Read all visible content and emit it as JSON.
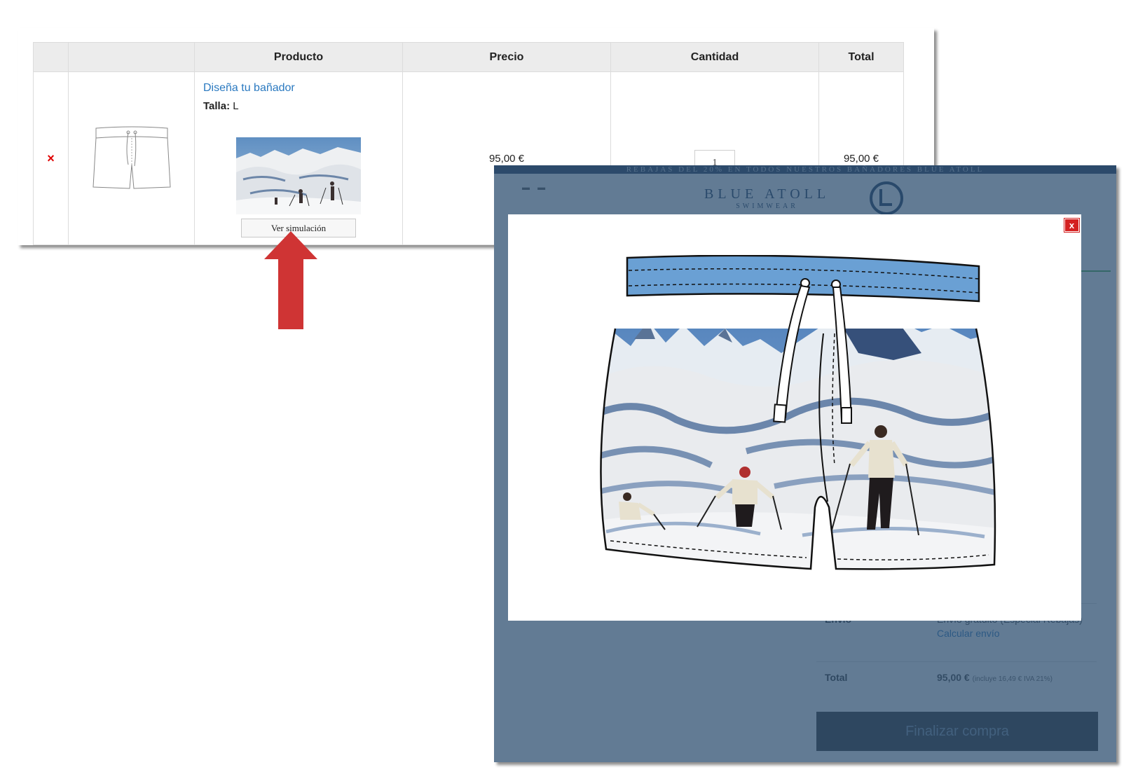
{
  "cart": {
    "headers": {
      "remove": "",
      "thumb": "",
      "product": "Producto",
      "price": "Precio",
      "quantity": "Cantidad",
      "total": "Total"
    },
    "row": {
      "remove_symbol": "×",
      "product_name": "Diseña tu bañador",
      "size_label": "Talla:",
      "size_value": "L",
      "simulation_button": "Ver simulación",
      "price": "95,00 €",
      "quantity": "1",
      "total": "95,00 €"
    }
  },
  "store": {
    "promo": "REBAJAS DEL 20% EN TODOS NUESTROS BAÑADORES BLUE ATOLL",
    "brand_name": "BLUE ATOLL",
    "brand_sub": "SWIMWEAR",
    "shipping_label": "Envío",
    "shipping_value": "Envío gratuito (Especial Rebajas)",
    "shipping_calc": "Calcular envío",
    "total_label": "Total",
    "total_value": "95,00 €",
    "total_tax": "(incluye 16,49 € IVA 21%)",
    "checkout_button": "Finalizar compra"
  },
  "modal": {
    "close_symbol": "x"
  },
  "colors": {
    "accent_red": "#d42020",
    "link_blue": "#2a79c0",
    "overlay": "#2d4f70",
    "arrow_red": "#cf3434"
  }
}
